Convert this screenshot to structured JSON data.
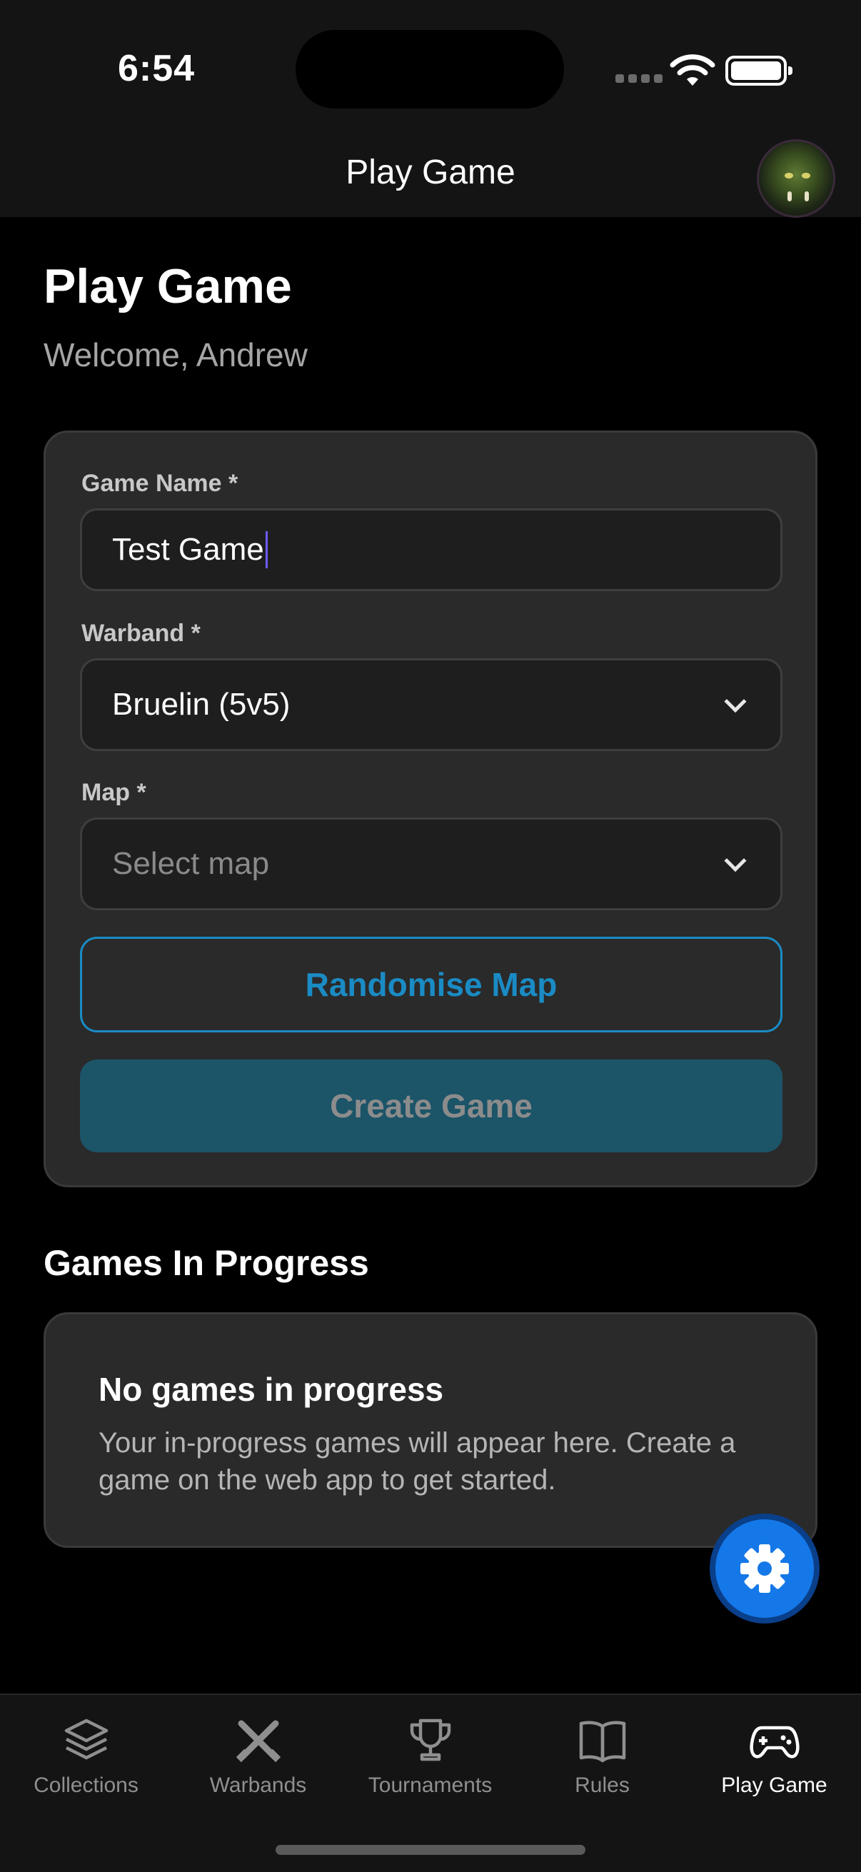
{
  "status_bar": {
    "time": "6:54"
  },
  "header": {
    "title": "Play Game"
  },
  "page": {
    "title": "Play Game",
    "welcome": "Welcome, Andrew"
  },
  "form": {
    "game_name_label": "Game Name *",
    "game_name_value": "Test Game",
    "warband_label": "Warband *",
    "warband_value": "Bruelin (5v5)",
    "map_label": "Map *",
    "map_placeholder": "Select map",
    "randomise_label": "Randomise Map",
    "create_label": "Create Game"
  },
  "games_in_progress": {
    "title": "Games In Progress",
    "empty_title": "No games in progress",
    "empty_text": "Your in-progress games will appear here. Create a game on the web app to get started."
  },
  "fab": {
    "icon": "gear-icon"
  },
  "tabs": [
    {
      "label": "Collections",
      "icon": "layers-icon",
      "active": false
    },
    {
      "label": "Warbands",
      "icon": "crossed-swords-icon",
      "active": false
    },
    {
      "label": "Tournaments",
      "icon": "trophy-icon",
      "active": false
    },
    {
      "label": "Rules",
      "icon": "book-icon",
      "active": false
    },
    {
      "label": "Play Game",
      "icon": "gamepad-icon",
      "active": true
    }
  ],
  "colors": {
    "accent": "#1a8bc4",
    "primary_button": "#1c5468",
    "fab": "#1578e8",
    "card": "#2a2a2a",
    "background": "#000000"
  }
}
